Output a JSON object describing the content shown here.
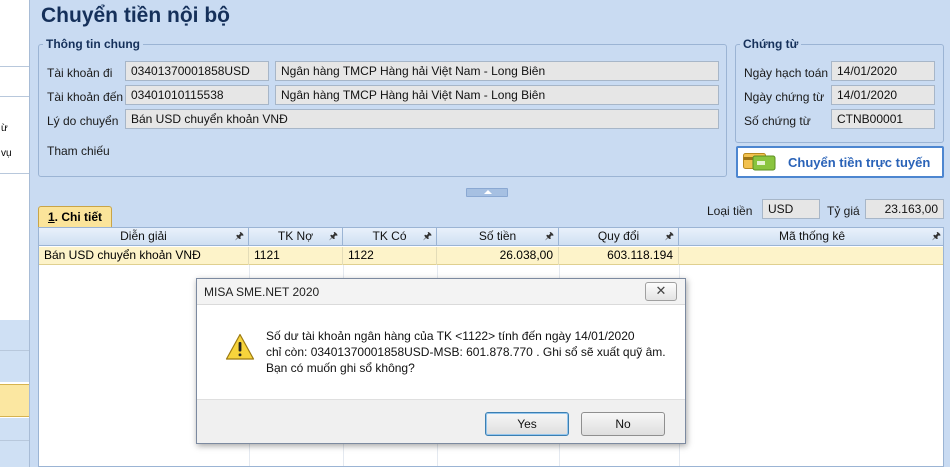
{
  "left_panel": {
    "fragments": [
      "ừ",
      "vụ"
    ]
  },
  "page_title": "Chuyển tiền nội bộ",
  "general_info": {
    "legend": "Thông tin chung",
    "from_account": {
      "label": "Tài khoản đi",
      "number": "03401370001858USD",
      "bank": "Ngân hàng TMCP Hàng hải Việt Nam - Long Biên"
    },
    "to_account": {
      "label": "Tài khoản đến",
      "number": "03401010115538",
      "bank": "Ngân hàng TMCP Hàng hải Việt Nam - Long Biên"
    },
    "reason": {
      "label": "Lý do chuyển",
      "value": "Bán USD chuyển khoản VNĐ"
    },
    "reference": {
      "label": "Tham chiếu"
    }
  },
  "voucher": {
    "legend": "Chứng từ",
    "posting_date": {
      "label": "Ngày hạch toán",
      "value": "14/01/2020"
    },
    "voucher_date": {
      "label": "Ngày chứng từ",
      "value": "14/01/2020"
    },
    "voucher_no": {
      "label": "Số chứng từ",
      "value": "CTNB00001"
    }
  },
  "online_transfer_button": "Chuyển tiền trực tuyến",
  "detail_tab": {
    "num": "1",
    "label": ". Chi tiết"
  },
  "currency": {
    "label": "Loại tiền",
    "value": "USD"
  },
  "exchange_rate": {
    "label": "Tỷ giá",
    "value": "23.163,00"
  },
  "grid": {
    "columns": [
      "Diễn giải",
      "TK Nợ",
      "TK Có",
      "Số tiền",
      "Quy đổi",
      "Mã thống kê"
    ],
    "rows": [
      [
        "Bán USD chuyển khoản VNĐ",
        "1121",
        "1122",
        "26.038,00",
        "603.118.194",
        ""
      ]
    ]
  },
  "dialog": {
    "title": "MISA SME.NET 2020",
    "close": "✕",
    "message_lines": [
      "Số dư tài khoản ngân hàng của TK <1122> tính đến ngày 14/01/2020",
      "chỉ còn: 03401370001858USD-MSB: 601.878.770 . Ghi sổ sẽ xuất quỹ âm.",
      "Bạn có muốn ghi sổ không?"
    ],
    "yes": "Yes",
    "no": "No"
  },
  "icons": {
    "pin": "pin-icon",
    "warning": "warning-icon",
    "online": "bank-card-icon",
    "collapse": "chevron-up-icon"
  }
}
